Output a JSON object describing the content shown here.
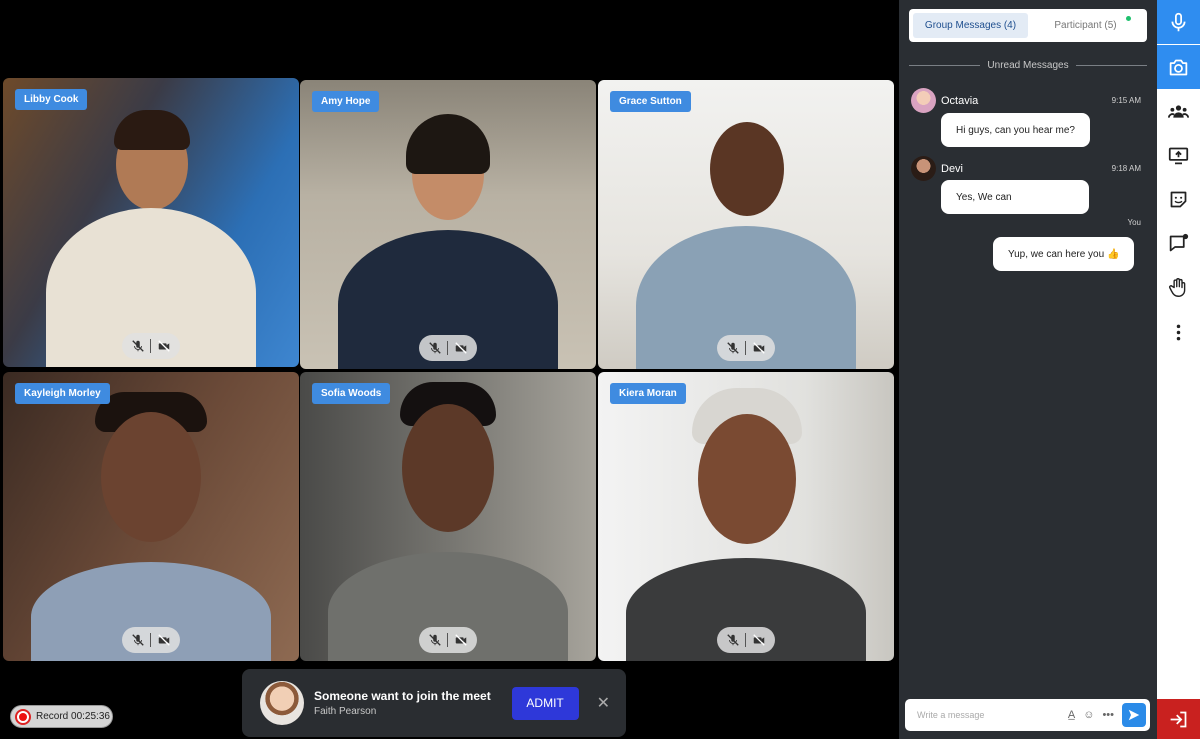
{
  "participants": [
    {
      "name": "Libby Cook"
    },
    {
      "name": "Amy Hope"
    },
    {
      "name": "Grace Sutton"
    },
    {
      "name": "Kayleigh Morley"
    },
    {
      "name": "Sofia Woods"
    },
    {
      "name": "Kiera Moran"
    }
  ],
  "record": {
    "label": "Record 00:25:36"
  },
  "join_request": {
    "title": "Someone want to join the meet",
    "name": "Faith Pearson",
    "admit_label": "ADMIT",
    "close_label": "✕"
  },
  "chat": {
    "tabs": [
      {
        "label": "Group Messages (4)"
      },
      {
        "label": "Participant (5)"
      }
    ],
    "divider_label": "Unread Messages",
    "messages": [
      {
        "sender": "Octavia",
        "time": "9:15 AM",
        "text": "Hi guys, can you hear me?"
      },
      {
        "sender": "Devi",
        "time": "9:18 AM",
        "text": "Yes, We can"
      },
      {
        "sender": "You",
        "text": "Yup, we can here you 👍"
      }
    ],
    "composer_placeholder": "Write a message"
  },
  "colors": {
    "accent_blue": "#2f8df0",
    "name_tag": "#3f8be0",
    "admit": "#2e38d9",
    "leave": "#c9211f",
    "panel_bg": "#2a2e33"
  },
  "rail_icons": [
    "microphone-icon",
    "camera-icon",
    "participants-icon",
    "share-screen-icon",
    "sticker-icon",
    "chat-icon",
    "raise-hand-icon",
    "more-icon",
    "leave-icon"
  ]
}
